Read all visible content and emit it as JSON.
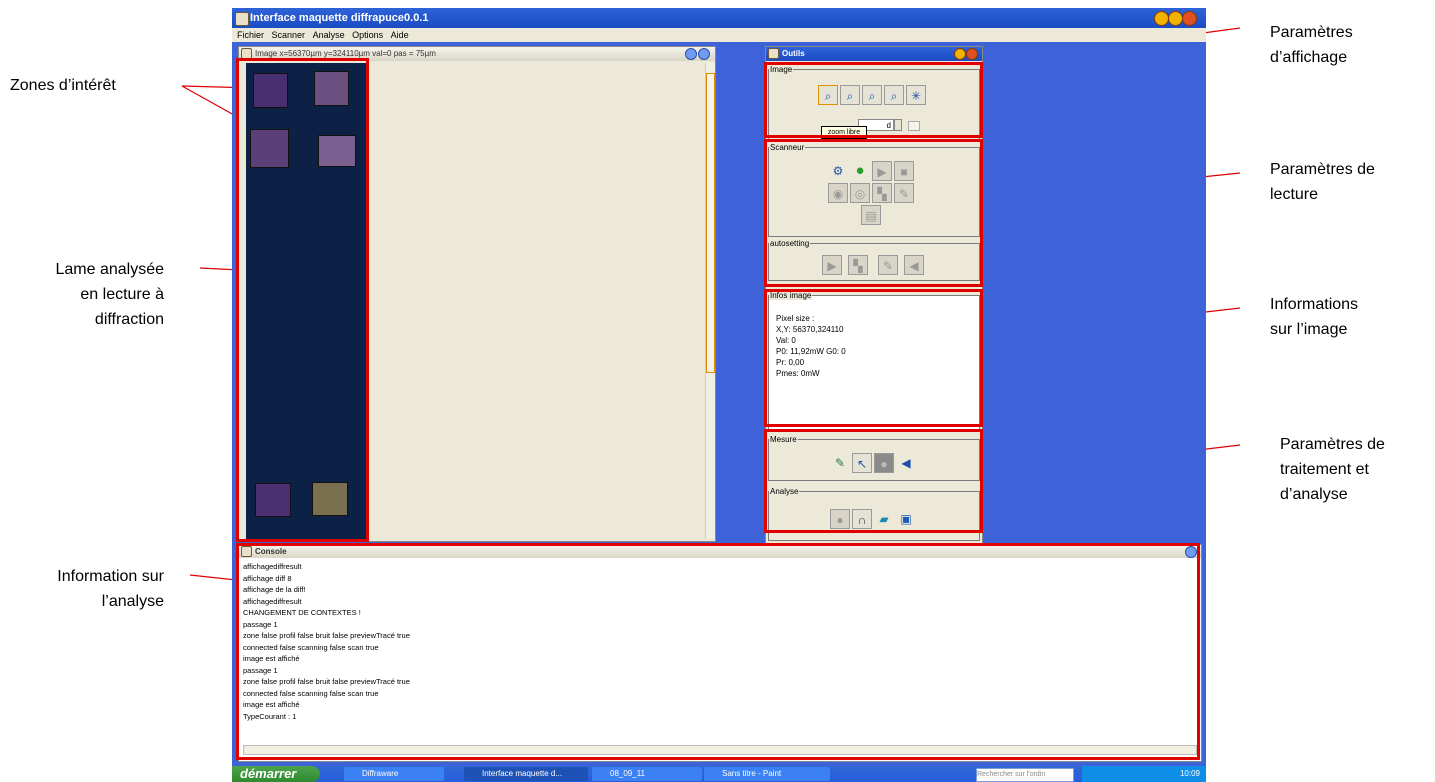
{
  "window": {
    "title": "Interface maquette diffrapuce0.0.1",
    "menu": [
      "Fichier",
      "Scanner",
      "Analyse",
      "Options",
      "Aide"
    ]
  },
  "image_frame": {
    "title": "Image   x=56370µm   y=324110µm    val=0   pas = 75µm"
  },
  "outils": {
    "title": "Outils",
    "image_group": "Image",
    "image_field_value": "d",
    "tooltip": "zoom libre",
    "scanneur_group": "Scanneur",
    "autosetting_group": "autosetting",
    "infos_group": "Infos image",
    "infos_lines": [
      "Pixel size :",
      "X,Y: 56370,324110",
      "Val: 0",
      "P0: 11,92mW    G0: 0",
      "Pr: 0,00",
      "Pmes: 0mW"
    ],
    "mesure_group": "Mesure",
    "analyse_group": "Analyse"
  },
  "console": {
    "title": "Console",
    "lines": [
      "affichagediffresult",
      "affichage diff 8",
      "affichage de la diff!",
      "affichagediffresult",
      "CHANGEMENT DE CONTEXTES !",
      "passage 1",
      "zone false profil false bruit false previewTracé true",
      "connected false scanning false scan true",
      "image est affiché",
      "passage 1",
      "zone false profil false bruit false previewTracé true",
      "connected false scanning false scan true",
      "image est affiché",
      "TypeCourant : 1"
    ]
  },
  "taskbar": {
    "start": "démarrer",
    "tasks": [
      "Diffraware",
      "Interface maquette d...",
      "08_09_11",
      "Sans titre - Paint"
    ],
    "search_placeholder": "Rechercher sur l'ordin",
    "clock": "10:09"
  },
  "annotations": {
    "zones": "Zones d’intérêt",
    "lame_1": "Lame analysée",
    "lame_2": "en lecture à",
    "lame_3": "diffraction",
    "info_analyse_1": "Information sur",
    "info_analyse_2": "l’analyse",
    "param_aff_1": "Paramètres",
    "param_aff_2": "d’affichage",
    "param_lect_1": "Paramètres de",
    "param_lect_2": "lecture",
    "info_img_1": "Informations",
    "info_img_2": "sur l’image",
    "param_trait_1": "Paramètres de",
    "param_trait_2": "traitement et",
    "param_trait_3": "d’analyse"
  },
  "colors": {
    "highlight": "#e00000",
    "xp_blue": "#3e63d8",
    "slide_bg": "#0d2146"
  }
}
